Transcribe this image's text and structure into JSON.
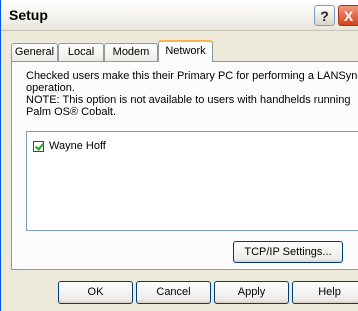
{
  "window": {
    "title": "Setup"
  },
  "titlebar": {
    "help_label": "?",
    "close_label": "X"
  },
  "tabs": [
    {
      "label": "General"
    },
    {
      "label": "Local"
    },
    {
      "label": "Modem"
    },
    {
      "label": "Network"
    }
  ],
  "active_tab": "Network",
  "network": {
    "description_lines": [
      "Checked users make this their Primary PC for performing a LANSync",
      "operation.",
      "NOTE: This option is not available to users with handhelds running",
      "Palm OS® Cobalt."
    ],
    "users": [
      {
        "name": "Wayne Hoff",
        "checked": true
      }
    ],
    "tcp_button_label": "TCP/IP Settings..."
  },
  "buttons": {
    "ok": "OK",
    "cancel": "Cancel",
    "apply": "Apply",
    "help": "Help"
  }
}
